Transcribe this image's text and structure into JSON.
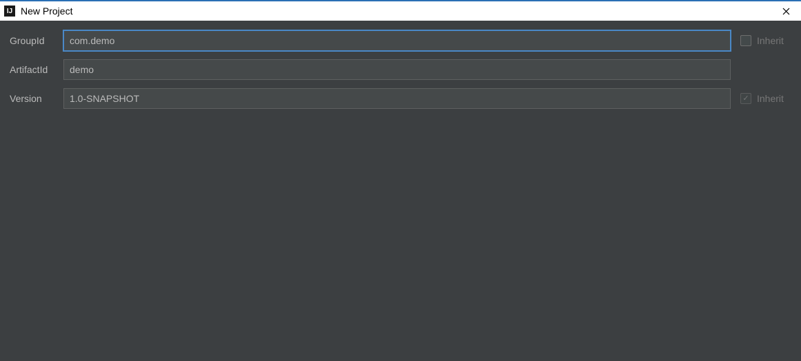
{
  "window": {
    "title": "New Project",
    "icon_text": "IJ"
  },
  "form": {
    "groupId": {
      "label": "GroupId",
      "value": "com.demo",
      "focused": true,
      "inherit_label": "Inherit",
      "inherit_checked": false,
      "inherit_visible": true
    },
    "artifactId": {
      "label": "ArtifactId",
      "value": "demo",
      "inherit_visible": false
    },
    "version": {
      "label": "Version",
      "value": "1.0-SNAPSHOT",
      "inherit_label": "Inherit",
      "inherit_checked": true,
      "inherit_visible": true
    }
  }
}
